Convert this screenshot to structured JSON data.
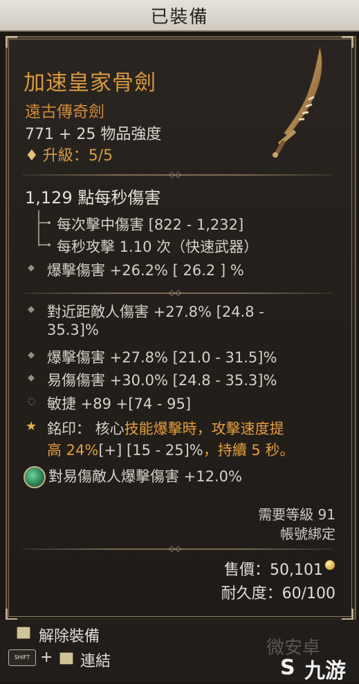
{
  "header": {
    "title": "已裝備"
  },
  "item": {
    "name": "加速皇家骨劍",
    "type": "遠古傳奇劍",
    "power": "771 + 25 物品強度",
    "upgrade": "升級：5/5"
  },
  "stats": {
    "dps": "1,129 點每秒傷害",
    "hit_damage": "每次擊中傷害 [822 - 1,232]",
    "attack_speed": "每秒攻擊 1.10 次（快速武器）",
    "implicit": "爆擊傷害 +26.2%   [ 26.2 ] %"
  },
  "affixes": {
    "a1_line1": "對近距敵人傷害 +27.8% [24.8 -",
    "a1_line2": "35.3]%",
    "a2": "爆擊傷害 +27.8% [21.0 - 31.5]%",
    "a3": "易傷傷害 +30.0% [24.8 - 35.3]%",
    "a4": "敏捷 +89 +[74 - 95]",
    "aspect_prefix": "銘印：  核心",
    "aspect_orange1": "技能爆擊時，攻擊速度提",
    "aspect_line2_a": "高 24%",
    "aspect_line2_b": "[+] [15 - 25]%",
    "aspect_line2_c": "，持續 5 秒。",
    "gem": "對易傷敵人爆擊傷害 +12.0%"
  },
  "requirements": {
    "level": "需要等級 91",
    "bound": "帳號綁定"
  },
  "economy": {
    "price": "售價：50,101",
    "durability": "耐久度：60/100"
  },
  "footer": {
    "unequip": "解除裝備",
    "plus": "+",
    "shift_key": "SHIFT",
    "link": "連結",
    "watermark": "微安卓",
    "logo": "九游"
  }
}
